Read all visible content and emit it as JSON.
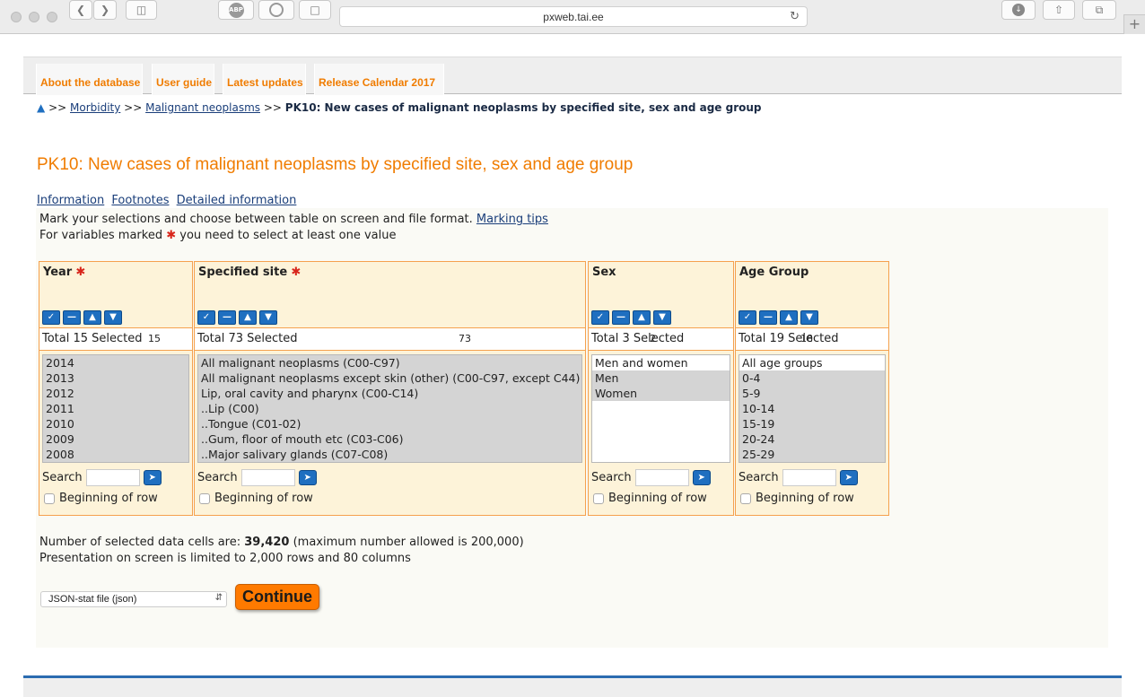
{
  "browser": {
    "url": "pxweb.tai.ee"
  },
  "nav": {
    "tabs": [
      "About the database",
      "User guide",
      "Latest updates",
      "Release Calendar 2017"
    ]
  },
  "breadcrumb": {
    "sep": ">>",
    "items": [
      "Morbidity",
      "Malignant neoplasms"
    ],
    "current": "PK10: New cases of malignant neoplasms by specified site, sex and age group"
  },
  "page": {
    "title": "PK10: New cases of malignant neoplasms by specified site, sex and age group",
    "links": [
      "Information",
      "Footnotes",
      "Detailed information"
    ],
    "instructions": "Mark your selections and choose between table on screen and file format.",
    "marking_tips": "Marking tips",
    "req_a": "For variables marked",
    "req_b": "you need to select at least one value"
  },
  "variables": [
    {
      "title": "Year",
      "required": true,
      "total_label": "Total 15 Selected",
      "selected": "15",
      "options": [
        {
          "label": "2014",
          "sel": true
        },
        {
          "label": "2013",
          "sel": true
        },
        {
          "label": "2012",
          "sel": true
        },
        {
          "label": "2011",
          "sel": true
        },
        {
          "label": "2010",
          "sel": true
        },
        {
          "label": "2009",
          "sel": true
        },
        {
          "label": "2008",
          "sel": true
        }
      ]
    },
    {
      "title": "Specified site",
      "required": true,
      "total_label": "Total 73 Selected",
      "selected": "73",
      "options": [
        {
          "label": "All malignant neoplasms (C00-C97)",
          "sel": true
        },
        {
          "label": "All malignant neoplasms except skin (other) (C00-C97, except C44)",
          "sel": true
        },
        {
          "label": "Lip, oral cavity and pharynx (C00-C14)",
          "sel": true
        },
        {
          "label": "..Lip (C00)",
          "sel": true
        },
        {
          "label": "..Tongue (C01-02)",
          "sel": true
        },
        {
          "label": "..Gum, floor of mouth etc (C03-C06)",
          "sel": true
        },
        {
          "label": "..Major salivary glands (C07-C08)",
          "sel": true
        }
      ]
    },
    {
      "title": "Sex",
      "required": false,
      "total_label": "Total 3 Selected",
      "selected": "2",
      "options": [
        {
          "label": "Men and women",
          "sel": false
        },
        {
          "label": "Men",
          "sel": true
        },
        {
          "label": "Women",
          "sel": true
        }
      ]
    },
    {
      "title": "Age Group",
      "required": false,
      "total_label": "Total 19 Selected",
      "selected": "18",
      "options": [
        {
          "label": "All age groups",
          "sel": false
        },
        {
          "label": "0-4",
          "sel": true
        },
        {
          "label": "5-9",
          "sel": true
        },
        {
          "label": "10-14",
          "sel": true
        },
        {
          "label": "15-19",
          "sel": true
        },
        {
          "label": "20-24",
          "sel": true
        },
        {
          "label": "25-29",
          "sel": true
        }
      ]
    }
  ],
  "controls": {
    "search_label": "Search",
    "beginning_of_row": "Beginning of row"
  },
  "summary": {
    "cells_prefix": "Number of selected data cells are:",
    "cells_value": "39,420",
    "cells_suffix": "(maximum number allowed is 200,000)",
    "presentation": "Presentation on screen is limited to 2,000 rows and 80 columns"
  },
  "output": {
    "format": "JSON-stat file (json)",
    "continue_label": "Continue"
  },
  "colors": {
    "accent": "#f07c00",
    "panel_border": "#f5a14e",
    "selection": "#d4d4d4",
    "button_blue": "#1f6fc0"
  }
}
